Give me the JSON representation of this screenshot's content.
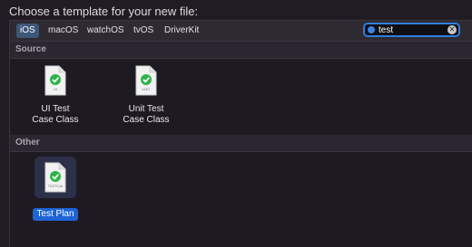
{
  "dialog": {
    "heading": "Choose a template for your new file:"
  },
  "platform_tabs": [
    {
      "label": "iOS",
      "selected": true
    },
    {
      "label": "macOS",
      "selected": false
    },
    {
      "label": "watchOS",
      "selected": false
    },
    {
      "label": "tvOS",
      "selected": false
    },
    {
      "label": "DriverKit",
      "selected": false
    }
  ],
  "search": {
    "value": "test"
  },
  "sections": [
    {
      "title": "Source",
      "items": [
        {
          "badge": "UI",
          "label": "UI Test\nCase Class"
        },
        {
          "badge": "UNIT",
          "label": "Unit Test\nCase Class"
        }
      ]
    },
    {
      "title": "Other",
      "items": [
        {
          "badge": "TESTPLAN",
          "label": "Test Plan",
          "selected": true
        }
      ]
    }
  ],
  "colors": {
    "accent": "#1d64d6",
    "check": "#2fb34a",
    "background": "#211c24"
  },
  "icons": [
    "search-icon",
    "clear-search-icon",
    "document-check-icon"
  ]
}
